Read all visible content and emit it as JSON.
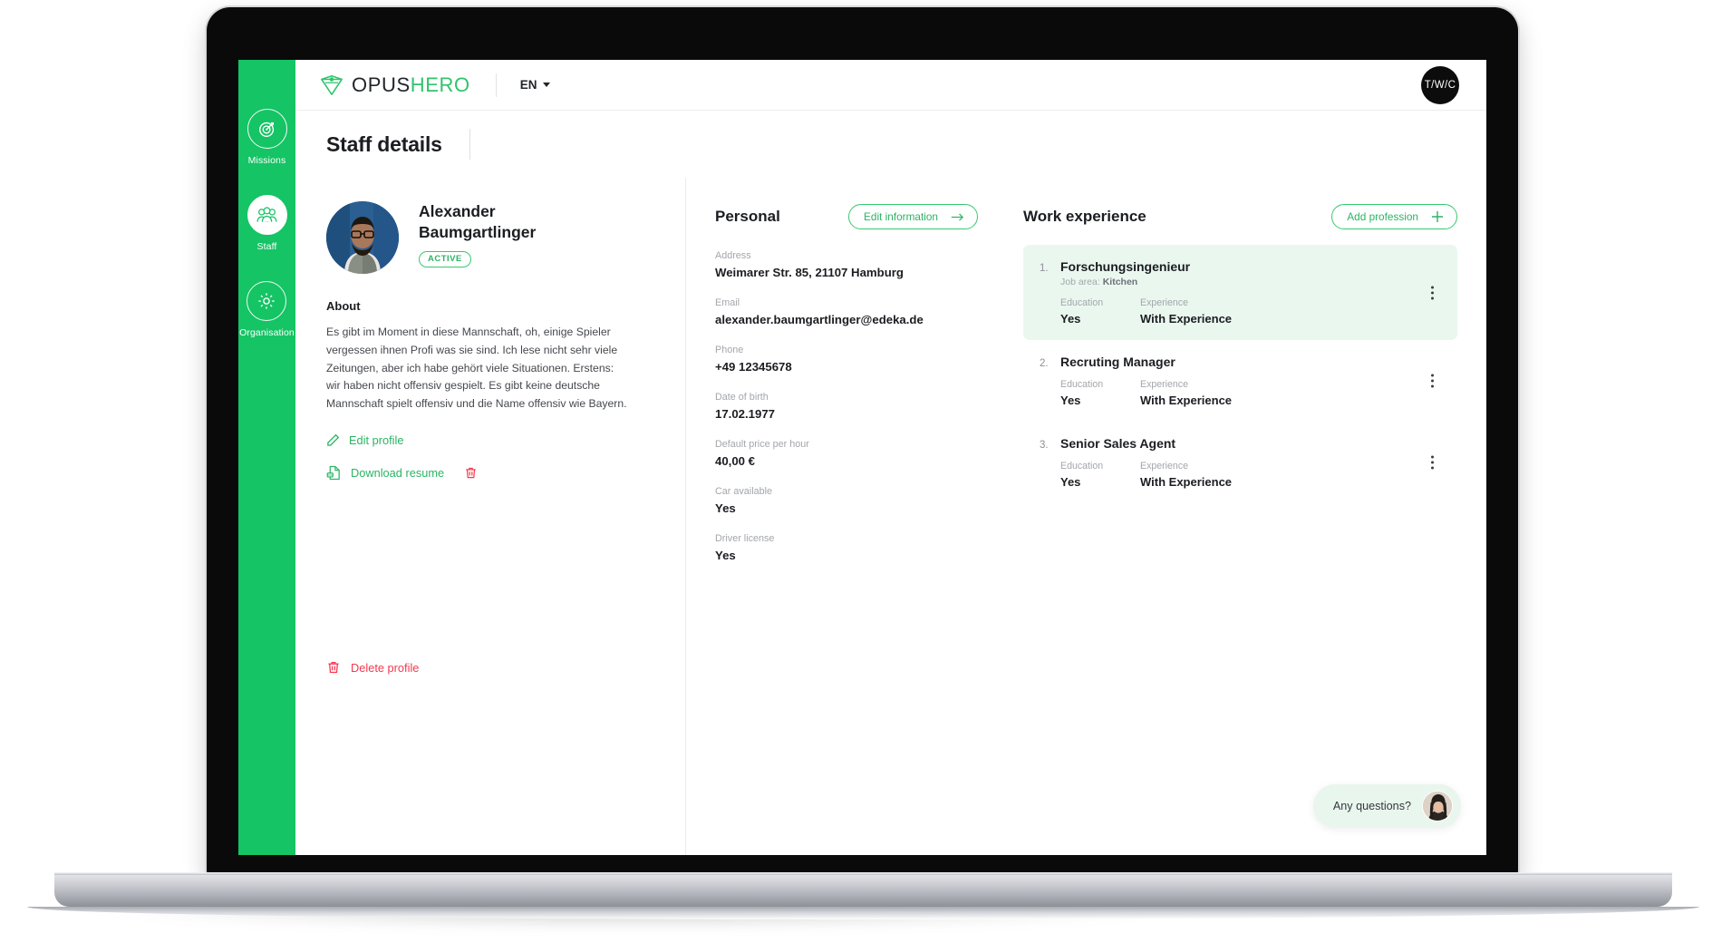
{
  "brand": {
    "logo_dark": "OPUS",
    "logo_green": "HERO",
    "logo_icon": "diamond-shield-icon"
  },
  "topbar": {
    "language": "EN",
    "user_initials": "T/W/C"
  },
  "sidebar": {
    "items": [
      {
        "label": "Missions",
        "icon": "target-icon",
        "active": false
      },
      {
        "label": "Staff",
        "icon": "people-icon",
        "active": true
      },
      {
        "label": "Organisation",
        "icon": "gear-icon",
        "active": false
      }
    ]
  },
  "page": {
    "title": "Staff details"
  },
  "profile": {
    "name": "Alexander Baumgartlinger",
    "status": "ACTIVE",
    "about_heading": "About",
    "about_text": "Es gibt im Moment in diese Mannschaft, oh, einige Spieler vergessen ihnen Profi was sie sind. Ich lese nicht sehr viele Zeitungen, aber ich habe gehört viele Situationen. Erstens: wir haben nicht offensiv gespielt. Es gibt keine deutsche Mannschaft spielt offensiv und die Name offensiv wie Bayern.",
    "edit_profile_label": "Edit profile",
    "download_resume_label": "Download resume",
    "delete_profile_label": "Delete profile"
  },
  "personal": {
    "title": "Personal",
    "edit_button": "Edit information",
    "fields": [
      {
        "label": "Address",
        "value": "Weimarer Str. 85, 21107 Hamburg"
      },
      {
        "label": "Email",
        "value": "alexander.baumgartlinger@edeka.de"
      },
      {
        "label": "Phone",
        "value": "+49 12345678"
      },
      {
        "label": "Date of birth",
        "value": "17.02.1977"
      },
      {
        "label": "Default price per hour",
        "value": "40,00 €"
      },
      {
        "label": "Car available",
        "value": "Yes"
      },
      {
        "label": "Driver license",
        "value": "Yes"
      }
    ]
  },
  "work": {
    "title": "Work experience",
    "add_button": "Add profession",
    "education_label": "Education",
    "experience_label": "Experience",
    "jobs": [
      {
        "num": "1.",
        "title": "Forschungsingenieur",
        "job_area_prefix": "Job area:",
        "job_area": "Kitchen",
        "education": "Yes",
        "experience": "With Experience",
        "highlight": true
      },
      {
        "num": "2.",
        "title": "Recruting Manager",
        "education": "Yes",
        "experience": "With Experience",
        "highlight": false
      },
      {
        "num": "3.",
        "title": "Senior Sales Agent",
        "education": "Yes",
        "experience": "With Experience",
        "highlight": false
      }
    ]
  },
  "chat": {
    "text": "Any questions?"
  },
  "colors": {
    "brand_green": "#15c464",
    "accent_green": "#2bb463",
    "highlight_green": "#eaf7ef",
    "danger_red": "#f5394f",
    "text_dark": "#1b1d21",
    "text_muted": "#a3a6ab"
  }
}
